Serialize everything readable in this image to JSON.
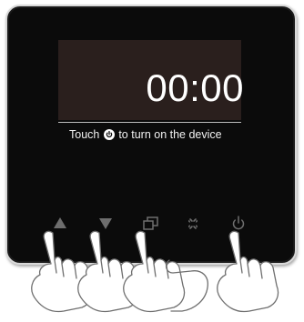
{
  "display": {
    "time": "00:00",
    "hint_prefix": "Touch",
    "hint_suffix": "to turn on the device"
  },
  "buttons": [
    {
      "name": "up",
      "icon": "triangle-up-icon"
    },
    {
      "name": "down",
      "icon": "triangle-down-icon"
    },
    {
      "name": "mode",
      "icon": "overlapping-squares-icon"
    },
    {
      "name": "fan",
      "icon": "fan-icon"
    },
    {
      "name": "power",
      "icon": "power-icon"
    }
  ],
  "colors": {
    "panel": "#0b0b0b",
    "screen": "#2a1f1d",
    "text": "#ffffff",
    "icon": "#6e6e6e",
    "bezel": "#d9d9d9"
  }
}
